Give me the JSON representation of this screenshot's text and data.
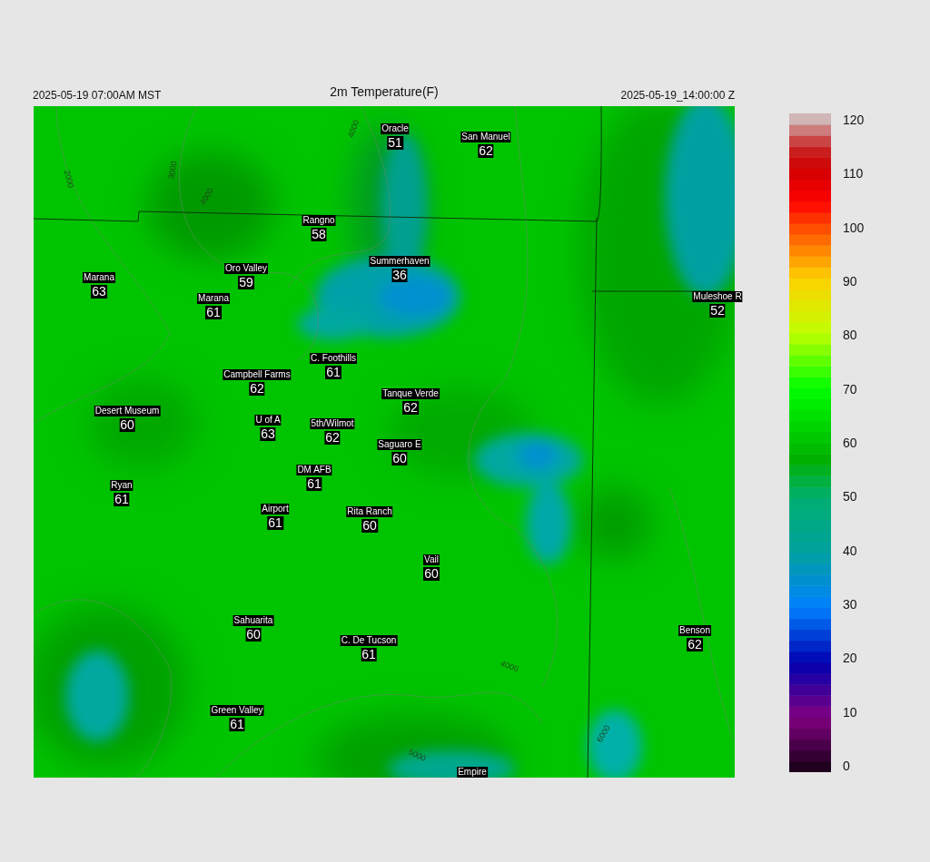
{
  "header": {
    "valid_time_local": "2025-05-19 07:00AM MST",
    "title": "2m Temperature(F)",
    "valid_time_utc": "2025-05-19_14:00:00 Z"
  },
  "map": {
    "stations": [
      {
        "name": "Oracle",
        "value": "51"
      },
      {
        "name": "San Manuel",
        "value": "62"
      },
      {
        "name": "Rangno",
        "value": "58"
      },
      {
        "name": "Summerhaven",
        "value": "36"
      },
      {
        "name": "Marana",
        "value": "63"
      },
      {
        "name": "Oro Valley",
        "value": "59"
      },
      {
        "name": "Marana",
        "value": "61"
      },
      {
        "name": "Muleshoe R",
        "value": "52"
      },
      {
        "name": "C. Foothills",
        "value": "61"
      },
      {
        "name": "Campbell Farms",
        "value": "62"
      },
      {
        "name": "Tanque Verde",
        "value": "62"
      },
      {
        "name": "Desert Museum",
        "value": "60"
      },
      {
        "name": "U of A",
        "value": "63"
      },
      {
        "name": "5th/Wilmot",
        "value": "62"
      },
      {
        "name": "Saguaro E",
        "value": "60"
      },
      {
        "name": "DM AFB",
        "value": "61"
      },
      {
        "name": "Ryan",
        "value": "61"
      },
      {
        "name": "Airport",
        "value": "61"
      },
      {
        "name": "Rita Ranch",
        "value": "60"
      },
      {
        "name": "Vail",
        "value": "60"
      },
      {
        "name": "Sahuarita",
        "value": "60"
      },
      {
        "name": "C. De Tucson",
        "value": "61"
      },
      {
        "name": "Benson",
        "value": "62"
      },
      {
        "name": "Green Valley",
        "value": "61"
      },
      {
        "name": "Empire"
      }
    ],
    "contour_labels": [
      "4000",
      "2000",
      "3000",
      "4000",
      "4000",
      "5000",
      "6000"
    ]
  },
  "colorbar": {
    "ticks": [
      "120",
      "110",
      "100",
      "90",
      "80",
      "70",
      "60",
      "50",
      "40",
      "30",
      "20",
      "10",
      "0"
    ]
  }
}
